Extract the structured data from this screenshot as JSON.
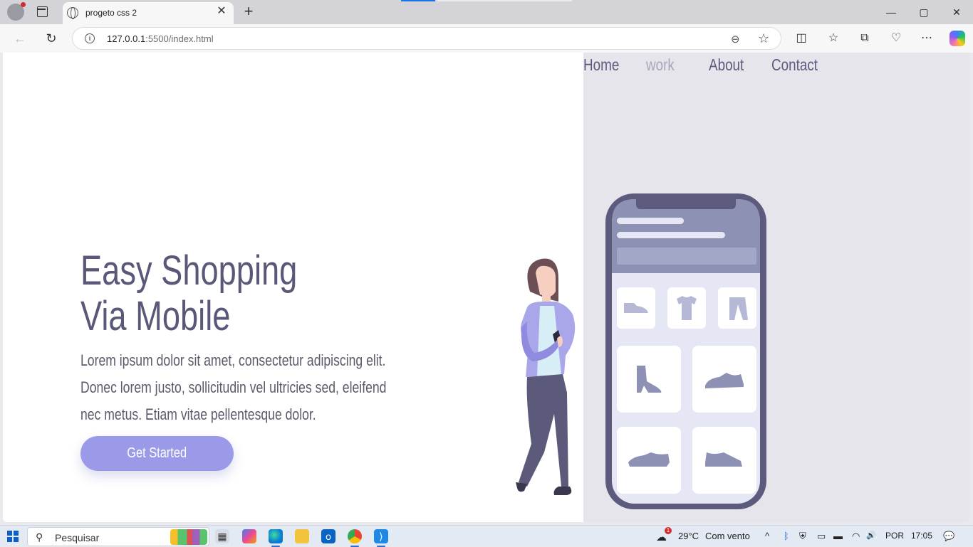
{
  "browser": {
    "tab_title": "progeto css 2",
    "close_glyph": "✕",
    "new_tab_glyph": "+",
    "url_host": "127.0.0.1",
    "url_path": ":5500/index.html",
    "window_controls": {
      "minimize": "—",
      "maximize": "▢",
      "close": "✕"
    },
    "nav_glyphs": {
      "back": "←",
      "refresh": "↻"
    },
    "toolbar_icons": [
      "split-screen-icon",
      "favorites-icon",
      "collections-icon",
      "browser-essentials-icon",
      "more-icon",
      "copilot-icon"
    ],
    "toolbar_glyphs": {
      "split": "◫",
      "favorites": "☆",
      "collections": "⧉",
      "essentials": "♡",
      "more": "⋯"
    },
    "zoom_glyph": "⊖",
    "star_glyph": "☆",
    "info_glyph": "i"
  },
  "page": {
    "nav": [
      {
        "label": "Home",
        "active": false
      },
      {
        "label": "work",
        "active": true
      },
      {
        "label": "About",
        "active": false
      },
      {
        "label": "Contact",
        "active": false
      }
    ],
    "hero_title_line1": "Easy Shopping",
    "hero_title_line2": "Via Mobile",
    "hero_text": "Lorem ipsum dolor sit amet, consectetur adipiscing elit. Donec lorem justo, sollicitudin vel ultricies sed, eleifend nec metus. Etiam vitae pellentesque dolor.",
    "cta_label": "Get Started",
    "colors": {
      "accent": "#9b9ae8",
      "title": "#5a5878",
      "panel_bg": "#e6e5ec",
      "phone_frame": "#5d5b7d",
      "phone_header": "#8d92b5"
    }
  },
  "taskbar": {
    "search_placeholder": "Pesquisar",
    "search_glyph": "⚲",
    "weather_temp": "29°C",
    "weather_text": "Com vento",
    "weather_alert": "1",
    "language": "POR",
    "time": "17:05",
    "apps": [
      "task-view-icon",
      "copilot-icon",
      "edge-icon",
      "file-explorer-icon",
      "outlook-icon",
      "chrome-icon",
      "vscode-icon"
    ],
    "tray_glyphs": {
      "chevron": "^",
      "bluetooth": "ᛒ",
      "volume": "🔊",
      "notifications": "💬"
    }
  }
}
